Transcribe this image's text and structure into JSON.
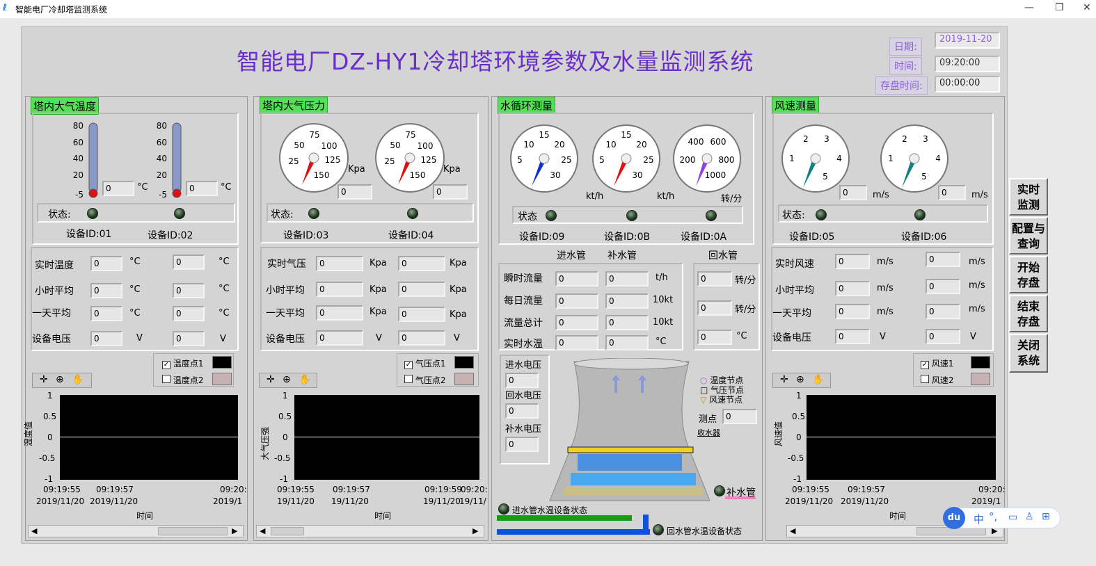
{
  "window": {
    "title": "智能电厂冷却塔监测系统",
    "minimize": "—",
    "maximize": "❐",
    "close": "✕"
  },
  "header": {
    "title": "智能电厂DZ-HY1冷却塔环境参数及水量监测系统",
    "date_label": "日期:",
    "date_value": "2019-11-20",
    "time_label": "时间:",
    "time_value": "09:20:00",
    "save_label": "存盘时间:",
    "save_value": "00:00:00"
  },
  "temp": {
    "title": "塔内大气温度",
    "ticks": [
      "80",
      "60",
      "40",
      "20",
      "-5"
    ],
    "unit": "°C",
    "t1": "0",
    "t2": "0",
    "state": "状态:",
    "dev1": "设备ID:01",
    "dev2": "设备ID:02",
    "rows": [
      {
        "label": "实时温度",
        "v1": "0",
        "u1": "°C",
        "v2": "0",
        "u2": "°C"
      },
      {
        "label": "小时平均",
        "v1": "0",
        "u1": "°C",
        "v2": "0",
        "u2": "°C"
      },
      {
        "label": "一天平均",
        "v1": "0",
        "u1": "°C",
        "v2": "0",
        "u2": "°C"
      },
      {
        "label": "设备电压",
        "v1": "0",
        "u1": "V",
        "v2": "0",
        "u2": "V"
      }
    ],
    "legend": [
      "温度点1",
      "温度点2"
    ],
    "ylabel": "温度值",
    "xlabel": "时间",
    "yticks": [
      "1",
      "0.5",
      "0",
      "-0.5",
      "-1"
    ],
    "xticks": [
      {
        "t": "09:19:55",
        "d": "2019/11/20"
      },
      {
        "t": "09:19:57",
        "d": "2019/11/20"
      },
      {
        "t": "09:20:",
        "d": "2019/1"
      }
    ]
  },
  "press": {
    "title": "塔内大气压力",
    "dial": [
      "25",
      "50",
      "75",
      "100",
      "125",
      "150"
    ],
    "unit": "Kpa",
    "p1": "0",
    "p2": "0",
    "state": "状态:",
    "dev1": "设备ID:03",
    "dev2": "设备ID:04",
    "rows": [
      {
        "label": "实时气压",
        "v1": "0",
        "u1": "Kpa",
        "v2": "0",
        "u2": "Kpa"
      },
      {
        "label": "小时平均",
        "v1": "0",
        "u1": "Kpa",
        "v2": "0",
        "u2": "Kpa"
      },
      {
        "label": "一天平均",
        "v1": "0",
        "u1": "Kpa",
        "v2": "0",
        "u2": "Kpa"
      },
      {
        "label": "设备电压",
        "v1": "0",
        "u1": "V",
        "v2": "0",
        "u2": "V"
      }
    ],
    "legend": [
      "气压点1",
      "气压点2"
    ],
    "ylabel": "大气压强",
    "xlabel": "时间",
    "yticks": [
      "1",
      "0.5",
      "0",
      "-0.5",
      "-1"
    ],
    "xticks": [
      {
        "t": "09:19:55",
        "d": "19/11/20"
      },
      {
        "t": "09:19:57",
        "d": "19/11/20"
      },
      {
        "t": "09:19:59",
        "d": "19/11/20"
      },
      {
        "t": "09:20:",
        "d": "19/11/"
      }
    ]
  },
  "water": {
    "title": "水循环测量",
    "dialA": [
      "5",
      "10",
      "15",
      "20",
      "25",
      "30"
    ],
    "dialC": [
      "200",
      "400",
      "600",
      "800",
      "1000"
    ],
    "u1": "kt/h",
    "u2": "kt/h",
    "u3": "转/分",
    "state": "状态",
    "dev1": "设备ID:09",
    "dev2": "设备ID:0B",
    "dev3": "设备ID:0A",
    "col1": "进水管",
    "col2": "补水管",
    "col3": "回水管",
    "rows": [
      {
        "label": "瞬时流量",
        "v1": "0",
        "v2": "0",
        "u": "t/h"
      },
      {
        "label": "每日流量",
        "v1": "0",
        "v2": "0",
        "u": "10kt"
      },
      {
        "label": "流量总计",
        "v1": "0",
        "v2": "0",
        "u": "10kt"
      },
      {
        "label": "实时水温",
        "v1": "0",
        "v2": "0",
        "u": "°C"
      }
    ],
    "ret": [
      {
        "v": "0",
        "u": "转/分"
      },
      {
        "v": "0",
        "u": "转/分"
      },
      {
        "v": "0",
        "u": "°C"
      }
    ],
    "volt": [
      {
        "label": "进水电压",
        "v": "0"
      },
      {
        "label": "回水电压",
        "v": "0"
      },
      {
        "label": "补水电压",
        "v": "0"
      }
    ],
    "legend": [
      "温度节点",
      "气压节点",
      "风速节点"
    ],
    "probe_label": "测点",
    "probe_value": "0",
    "collector": "收水器",
    "supply": "补水管",
    "in_status": "进水管水温设备状态",
    "ret_status": "回水管水温设备状态"
  },
  "wind": {
    "title": "风速测量",
    "dial": [
      "1",
      "2",
      "3",
      "4",
      "5"
    ],
    "unit": "m/s",
    "w1": "0",
    "w2": "0",
    "state": "状态:",
    "dev1": "设备ID:05",
    "dev2": "设备ID:06",
    "rows": [
      {
        "label": "实时风速",
        "v1": "0",
        "u1": "m/s",
        "v2": "0",
        "u2": "m/s"
      },
      {
        "label": "小时平均",
        "v1": "0",
        "u1": "m/s",
        "v2": "0",
        "u2": "m/s"
      },
      {
        "label": "一天平均",
        "v1": "0",
        "u1": "m/s",
        "v2": "0",
        "u2": "m/s"
      },
      {
        "label": "设备电压",
        "v1": "0",
        "u1": "V",
        "v2": "0",
        "u2": "V"
      }
    ],
    "legend": [
      "风速1",
      "风速2"
    ],
    "ylabel": "风速值",
    "xlabel": "时间",
    "yticks": [
      "1",
      "0.5",
      "0",
      "-0.5",
      "-1"
    ],
    "xticks": [
      {
        "t": "09:19:55",
        "d": "2019/11/20"
      },
      {
        "t": "09:19:57",
        "d": "2019/11/20"
      },
      {
        "t": "09:20:",
        "d": "2019/1"
      }
    ]
  },
  "buttons": [
    "实时\n监测",
    "配置与\n查询",
    "开始\n存盘",
    "结束\n存盘",
    "关闭\n系统"
  ],
  "ime": {
    "logo": "du",
    "lang": "中",
    "punct": "°,",
    "icons": [
      "keyboard-icon",
      "user-icon",
      "grid-icon"
    ]
  },
  "colors": {
    "accent": "#6a2fc9",
    "section": "#57e057",
    "needle_red": "#e01010",
    "needle_blue": "#1030d0",
    "needle_purple": "#9040e0",
    "needle_teal": "#108080"
  }
}
